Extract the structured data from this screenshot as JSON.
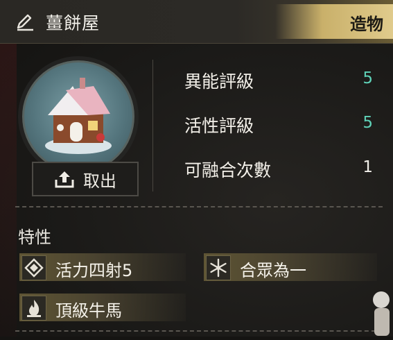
{
  "header": {
    "title": "薑餅屋",
    "category_badge": "造物",
    "edit_icon": "pencil-icon"
  },
  "portrait": {
    "subject_icon": "gingerbread-house-icon",
    "withdraw_label": "取出",
    "withdraw_icon": "upload-icon"
  },
  "stats": [
    {
      "name": "異能評級",
      "value": "5",
      "color": "#5fd2b8"
    },
    {
      "name": "活性評級",
      "value": "5",
      "color": "#5fd2b8"
    },
    {
      "name": "可融合次數",
      "value": "1",
      "color": "#f2f0ea"
    }
  ],
  "traits": {
    "title": "特性",
    "items": [
      {
        "name": "活力四射5",
        "icon": "diamond-icon"
      },
      {
        "name": "合眾為一",
        "icon": "snowflake-icon"
      },
      {
        "name": "頂級牛馬",
        "icon": "flame-icon"
      }
    ]
  },
  "colors": {
    "accent_gold": "#c9b06a",
    "stat_highlight": "#5fd2b8"
  }
}
